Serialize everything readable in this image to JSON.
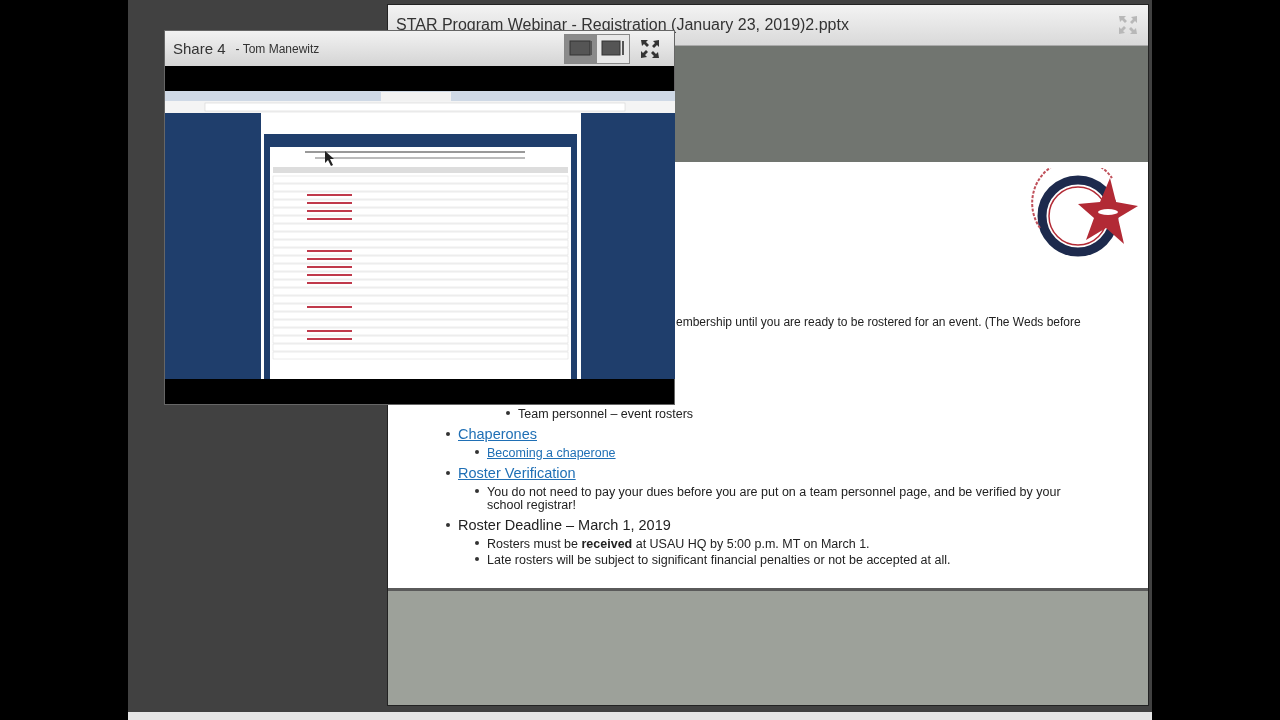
{
  "presentation": {
    "title": "STAR Program Webinar - Registration (January 23, 2019)2.pptx",
    "slide": {
      "partial_line": "embership until you are ready to be rostered for an event. (The Weds before",
      "continued": [
        {
          "kind": "text",
          "text": "Team personnel – event rosters"
        }
      ],
      "bullets": [
        {
          "kind": "link",
          "text": "Chaperones",
          "children": [
            {
              "kind": "link",
              "text": "Becoming a chaperone"
            }
          ]
        },
        {
          "kind": "link",
          "text": "Roster Verification",
          "children": [
            {
              "kind": "text",
              "text": "You do not need to pay your dues before you are put on a team personnel page, and be verified by your school registrar!"
            }
          ]
        },
        {
          "kind": "text",
          "text": "Roster Deadline – March 1, 2019",
          "children": [
            {
              "kind": "text",
              "text": "Rosters must be **received** at USAU HQ by 5:00 p.m. MT on March 1."
            },
            {
              "kind": "text",
              "text": "Late rosters will be subject to significant financial penalties or not be accepted at all."
            }
          ]
        }
      ]
    }
  },
  "share": {
    "title": "Share 4",
    "presenter": "- Tom Manewitz",
    "view_modes": [
      {
        "selected": true
      },
      {
        "selected": false
      }
    ]
  }
}
